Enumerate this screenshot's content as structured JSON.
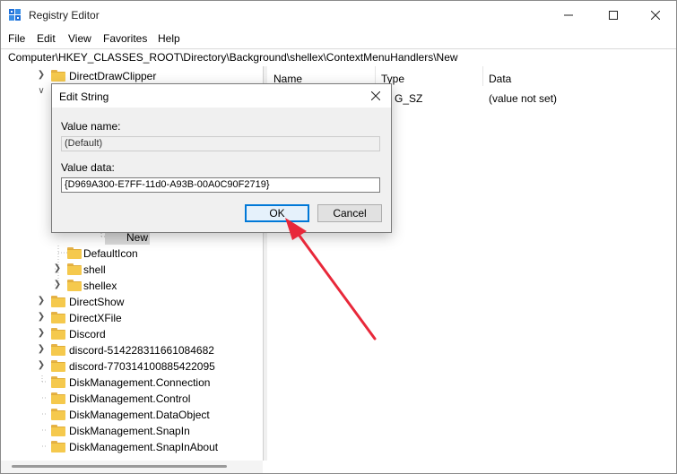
{
  "window": {
    "title": "Registry Editor"
  },
  "menu": [
    "File",
    "Edit",
    "View",
    "Favorites",
    "Help"
  ],
  "address": "Computer\\HKEY_CLASSES_ROOT\\Directory\\Background\\shellex\\ContextMenuHandlers\\New",
  "tree": [
    {
      "label": "DirectDrawClipper"
    },
    {
      "label": ""
    },
    {
      "label": ""
    },
    {
      "label": ""
    },
    {
      "label": ""
    },
    {
      "label": ""
    },
    {
      "label": ""
    },
    {
      "label": ""
    },
    {
      "label": ""
    },
    {
      "label": "New"
    },
    {
      "label": "DefaultIcon"
    },
    {
      "label": "shell"
    },
    {
      "label": "shellex"
    },
    {
      "label": "DirectShow"
    },
    {
      "label": "DirectXFile"
    },
    {
      "label": "Discord"
    },
    {
      "label": "discord-514228311661084682"
    },
    {
      "label": "discord-770314100885422095"
    },
    {
      "label": "DiskManagement.Connection"
    },
    {
      "label": "DiskManagement.Control"
    },
    {
      "label": "DiskManagement.DataObject"
    },
    {
      "label": "DiskManagement.SnapIn"
    },
    {
      "label": "DiskManagement.SnapInAbout"
    }
  ],
  "list": {
    "columns": [
      "Name",
      "Type",
      "Data"
    ],
    "rows": [
      {
        "type": "G_SZ",
        "data": "(value not set)"
      }
    ]
  },
  "dialog": {
    "title": "Edit String",
    "value_name_label": "Value name:",
    "value_name": "(Default)",
    "value_data_label": "Value data:",
    "value_data": "{D969A300-E7FF-11d0-A93B-00A0C90F2719}",
    "ok_label": "OK",
    "cancel_label": "Cancel"
  },
  "colors": {
    "accent": "#0078d7",
    "arrow": "#e8283a",
    "folder": "#f5c94d"
  },
  "icons": [
    "registry-editor-icon",
    "minimize-icon",
    "maximize-icon",
    "close-icon",
    "folder-icon",
    "chevron-right-icon",
    "chevron-down-icon",
    "red-arrow-annotation"
  ]
}
